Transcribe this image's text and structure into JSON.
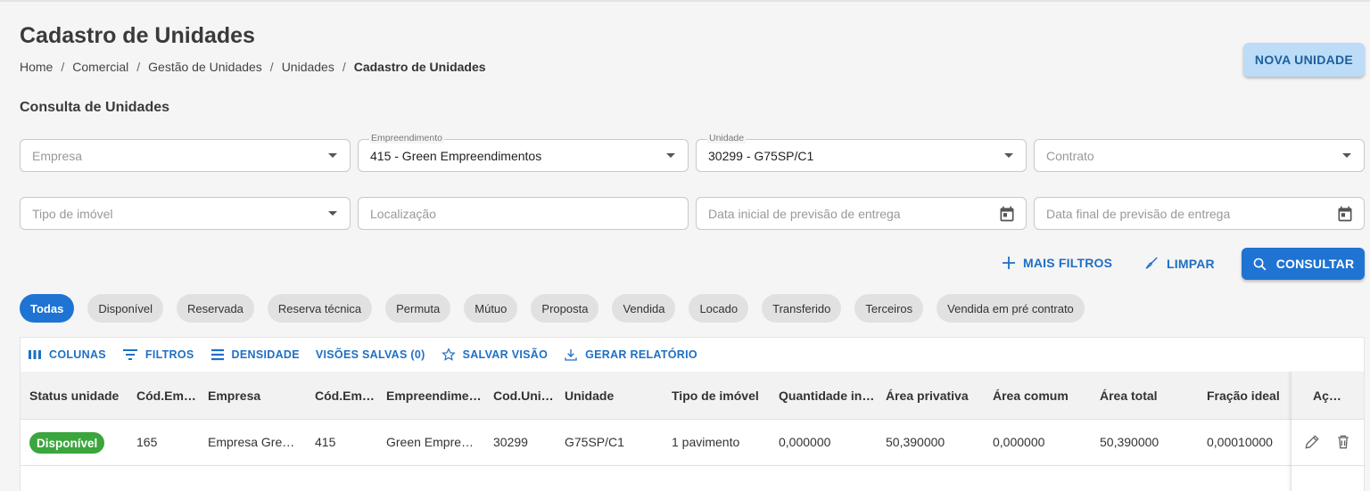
{
  "page": {
    "title": "Cadastro de Unidades",
    "breadcrumb": [
      "Home",
      "Comercial",
      "Gestão de Unidades",
      "Unidades",
      "Cadastro de Unidades"
    ],
    "breadcrumb_sep": "/",
    "new_button": "NOVA UNIDADE"
  },
  "filters": {
    "section_title": "Consulta de Unidades",
    "empresa": {
      "placeholder": "Empresa"
    },
    "empreendimento": {
      "label": "Empreendimento",
      "value": "415 - Green Empreendimentos"
    },
    "unidade": {
      "label": "Unidade",
      "value": "30299 - G75SP/C1"
    },
    "contrato": {
      "placeholder": "Contrato"
    },
    "tipo_imovel": {
      "placeholder": "Tipo de imóvel"
    },
    "localizacao": {
      "placeholder": "Localização"
    },
    "data_inicial": {
      "placeholder": "Data inicial de previsão de entrega"
    },
    "data_final": {
      "placeholder": "Data final de previsão de entrega"
    },
    "mais_filtros": "MAIS FILTROS",
    "limpar": "LIMPAR",
    "consultar": "CONSULTAR"
  },
  "status_chips": [
    "Todas",
    "Disponível",
    "Reservada",
    "Reserva técnica",
    "Permuta",
    "Mútuo",
    "Proposta",
    "Vendida",
    "Locado",
    "Transferido",
    "Terceiros",
    "Vendida em pré contrato"
  ],
  "active_chip": "Todas",
  "toolbar": {
    "colunas": "COLUNAS",
    "filtros": "FILTROS",
    "densidade": "DENSIDADE",
    "visoes": "VISÕES SALVAS (0)",
    "salvar_visao": "SALVAR VISÃO",
    "gerar_relatorio": "GERAR RELATÓRIO"
  },
  "table": {
    "columns": [
      "Status unidade",
      "Cód.Empresa",
      "Empresa",
      "Cód.Empreendimento",
      "Empreendimento",
      "Cod.Unidade",
      "Unidade",
      "Tipo de imóvel",
      "Quantidade independente",
      "Área privativa",
      "Área comum",
      "Área total",
      "Fração ideal",
      "Ações"
    ],
    "rows": [
      {
        "status": "Disponível",
        "cod_empresa": "165",
        "empresa": "Empresa Green Empreendimentos",
        "cod_empreendimento": "415",
        "empreendimento": "Green Empreendimentos",
        "cod_unidade": "30299",
        "unidade": "G75SP/C1",
        "tipo_imovel": "1 pavimento",
        "quantidade": "0,000000",
        "area_privativa": "50,390000",
        "area_comum": "0,000000",
        "area_total": "50,390000",
        "fracao_ideal": "0,00010000"
      }
    ]
  },
  "colors": {
    "primary": "#1f73d3",
    "available_badge": "#3aa63d",
    "new_button_bg": "#bcdcf7"
  }
}
